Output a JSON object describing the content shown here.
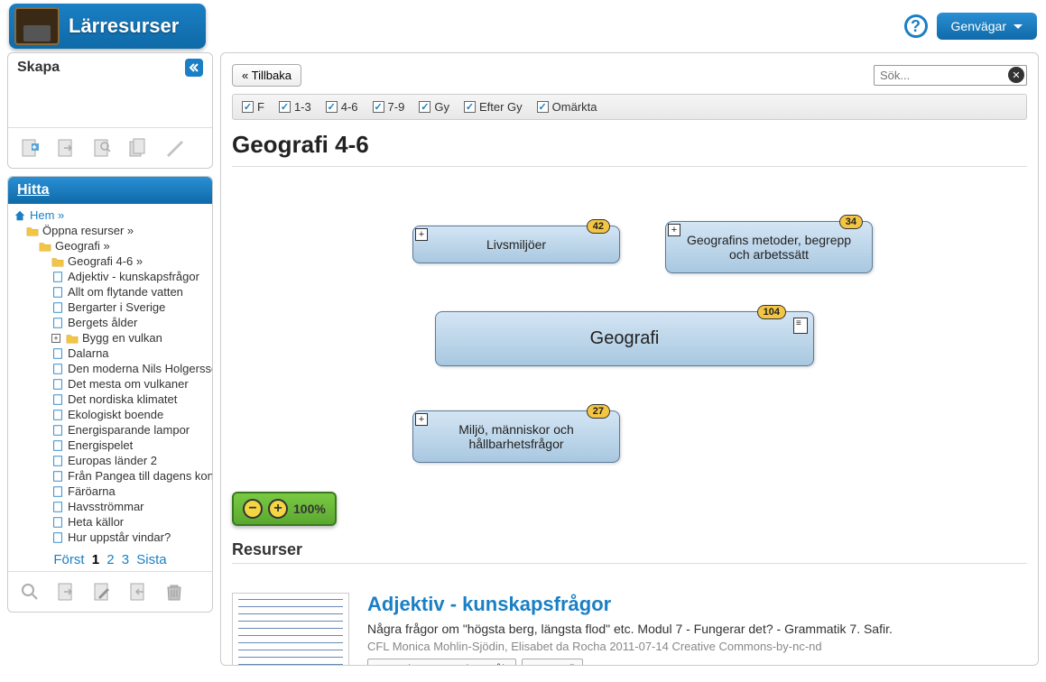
{
  "brand": "Lärresurser",
  "top": {
    "genvagar": "Genvägar"
  },
  "skapa": {
    "title": "Skapa"
  },
  "hitta": {
    "title": "Hitta"
  },
  "tree": {
    "home": "Hem »",
    "items": [
      {
        "label": "Öppna resurser »",
        "indent": 1,
        "icon": "folder"
      },
      {
        "label": "Geografi »",
        "indent": 2,
        "icon": "folder"
      },
      {
        "label": "Geografi 4-6 »",
        "indent": 3,
        "icon": "folder"
      },
      {
        "label": "Adjektiv - kunskapsfrågor",
        "indent": 4,
        "icon": "page"
      },
      {
        "label": "Allt om flytande vatten",
        "indent": 4,
        "icon": "page"
      },
      {
        "label": "Bergarter i Sverige",
        "indent": 4,
        "icon": "page"
      },
      {
        "label": "Bergets ålder",
        "indent": 4,
        "icon": "page"
      },
      {
        "label": "Bygg en vulkan",
        "indent": 4,
        "icon": "folder",
        "expand": true
      },
      {
        "label": "Dalarna",
        "indent": 4,
        "icon": "page"
      },
      {
        "label": "Den moderna Nils Holgersso",
        "indent": 4,
        "icon": "page"
      },
      {
        "label": "Det mesta om vulkaner",
        "indent": 4,
        "icon": "page"
      },
      {
        "label": "Det nordiska klimatet",
        "indent": 4,
        "icon": "page"
      },
      {
        "label": "Ekologiskt boende",
        "indent": 4,
        "icon": "page"
      },
      {
        "label": "Energisparande lampor",
        "indent": 4,
        "icon": "page"
      },
      {
        "label": "Energispelet",
        "indent": 4,
        "icon": "page"
      },
      {
        "label": "Europas länder 2",
        "indent": 4,
        "icon": "page"
      },
      {
        "label": "Från Pangea till dagens kon",
        "indent": 4,
        "icon": "page"
      },
      {
        "label": "Färöarna",
        "indent": 4,
        "icon": "page"
      },
      {
        "label": "Havsströmmar",
        "indent": 4,
        "icon": "page"
      },
      {
        "label": "Heta källor",
        "indent": 4,
        "icon": "page"
      },
      {
        "label": "Hur uppstår vindar?",
        "indent": 4,
        "icon": "page"
      }
    ]
  },
  "pager": {
    "first": "Först",
    "pages": [
      "1",
      "2",
      "3"
    ],
    "last": "Sista",
    "current": "1"
  },
  "main": {
    "back": "« Tillbaka",
    "search_placeholder": "Sök...",
    "filters": [
      "F",
      "1-3",
      "4-6",
      "7-9",
      "Gy",
      "Efter Gy",
      "Omärkta"
    ],
    "title": "Geografi 4-6",
    "zoom": "100%",
    "resources_heading": "Resurser"
  },
  "nodes": {
    "central": {
      "label": "Geografi",
      "badge": "104"
    },
    "n1": {
      "label": "Livsmiljöer",
      "badge": "42"
    },
    "n2": {
      "label": "Geografins metoder, begrepp och arbetssätt",
      "badge": "34"
    },
    "n3": {
      "label": "Miljö, människor och hållbarhetsfrågor",
      "badge": "27"
    }
  },
  "resource": {
    "title": "Adjektiv - kunskapsfrågor",
    "desc": "Några frågor om \"högsta berg, längsta flod\" etc. Modul 7 - Fungerar det? - Grammatik 7. Safir.",
    "meta": "CFL Monica Mohlin-Sjödin, Elisabet da Rocha 2011-07-14 Creative Commons-by-nc-nd",
    "tags": [
      "Svenska som andraspråk",
      "Geografi"
    ]
  }
}
